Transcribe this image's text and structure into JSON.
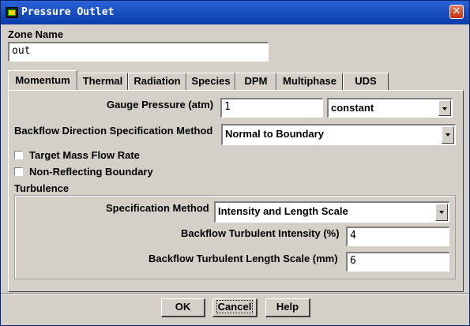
{
  "window": {
    "title": "Pressure Outlet"
  },
  "zone": {
    "label": "Zone Name",
    "value": "out"
  },
  "tabs": [
    {
      "label": "Momentum",
      "active": true
    },
    {
      "label": "Thermal"
    },
    {
      "label": "Radiation"
    },
    {
      "label": "Species"
    },
    {
      "label": "DPM"
    },
    {
      "label": "Multiphase"
    },
    {
      "label": "UDS"
    }
  ],
  "momentum": {
    "gauge_pressure_label": "Gauge Pressure (atm)",
    "gauge_pressure_value": "1",
    "gauge_pressure_profile": "constant",
    "backflow_method_label": "Backflow Direction Specification Method",
    "backflow_method_value": "Normal to Boundary",
    "target_mass_flow_label": "Target Mass Flow Rate",
    "target_mass_flow_checked": false,
    "non_reflecting_label": "Non-Reflecting Boundary",
    "non_reflecting_checked": false
  },
  "turbulence": {
    "group_label": "Turbulence",
    "spec_method_label": "Specification Method",
    "spec_method_value": "Intensity and Length Scale",
    "intensity_label": "Backflow Turbulent Intensity (%)",
    "intensity_value": "4",
    "length_scale_label": "Backflow Turbulent Length Scale (mm)",
    "length_scale_value": "6"
  },
  "buttons": {
    "ok": "OK",
    "cancel": "Cancel",
    "help": "Help"
  },
  "colors": {
    "titlebar": "#0a3ba8",
    "face": "#d4d0c8",
    "close": "#c03010"
  }
}
